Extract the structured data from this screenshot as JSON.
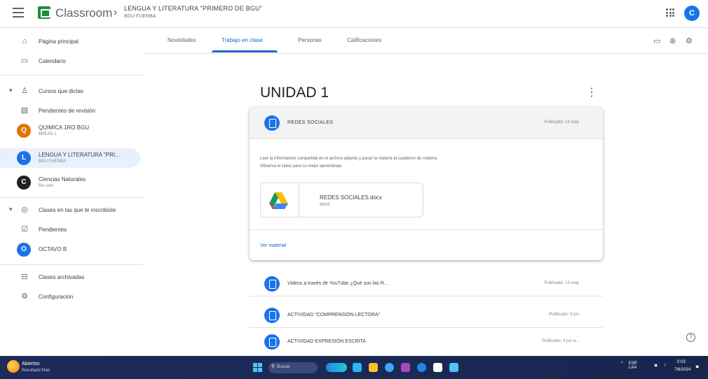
{
  "header": {
    "brand": "Classroom",
    "crumb_sep": "›",
    "course_title": "LENGUA Y LITERATURA \"PRIMERO DE BGU\"",
    "course_sub": "BGU FUERBA",
    "account_initial": "C"
  },
  "sidebar": {
    "items": [
      {
        "label": "Página principal",
        "icon": "home-icon"
      },
      {
        "label": "Calendario",
        "icon": "calendar-icon"
      },
      {
        "label": "Cursos que dictas",
        "icon": "people-icon"
      },
      {
        "label": "Pendientes de revisión",
        "icon": "folder-icon"
      },
      {
        "label": "Clases en las que te inscribiste",
        "icon": "school-icon"
      },
      {
        "label": "Pendientes",
        "icon": "todo-icon"
      },
      {
        "label": "Clases archivadas",
        "icon": "archive-icon"
      },
      {
        "label": "Configuración",
        "icon": "settings-icon"
      }
    ],
    "teaching_classes": [
      {
        "initial": "Q",
        "name": "QUIMICA 1RO BGU",
        "sub": "BREAD 1",
        "color": "#e37400"
      },
      {
        "initial": "L",
        "name": "LENGUA Y LITERATURA \"PRI...",
        "sub": "BGU FUERBA",
        "color": "#1a73e8"
      },
      {
        "initial": "C",
        "name": "Ciencias Naturales",
        "sub": "Bio sets",
        "color": "#202124"
      }
    ],
    "enrolled_classes": [
      {
        "initial": "O",
        "name": "OCTAVO B",
        "sub": "",
        "color": "#1a73e8"
      }
    ]
  },
  "tabs": [
    {
      "label": "Novedades"
    },
    {
      "label": "Trabajo en clase"
    },
    {
      "label": "Personas"
    },
    {
      "label": "Calificaciones"
    }
  ],
  "main": {
    "unit_title": "UNIDAD 1",
    "more_glyph": "⋮",
    "card": {
      "title": "REDES SOCIALES",
      "date": "Publicado: 13 may",
      "desc_line1": "Leer la información compartida en el archivo adjunto y pasar la materia al cuaderno de materia.",
      "desc_line2": "Observa el video para su mejor aprendizaje",
      "attachment_name": "REDES SOCIALES.docx",
      "attachment_type": "Word",
      "link": "Ver material"
    },
    "rows": [
      {
        "title": "Videos a través de YouTube ¿Qué son las R...",
        "date": "Publicado: 13 may"
      },
      {
        "title": "ACTIVIDAD \"COMPRENSIÓN LECTORA\"",
        "date": "Publicado: 9 jun"
      },
      {
        "title": "ACTIVIDAD EXPRESIÓN ESCRITA",
        "date": "Publicado: 4 jun a..."
      }
    ]
  },
  "taskbar": {
    "weather_title": "Abiertos",
    "weather_sub": "Resultado final",
    "search": "Buscar",
    "tray_lang": "ESP LAA",
    "clock_time": "0:03",
    "clock_date": "7/6/2024"
  },
  "colors": {
    "accent": "#1967d2",
    "task_icon": "#1a73e8"
  }
}
